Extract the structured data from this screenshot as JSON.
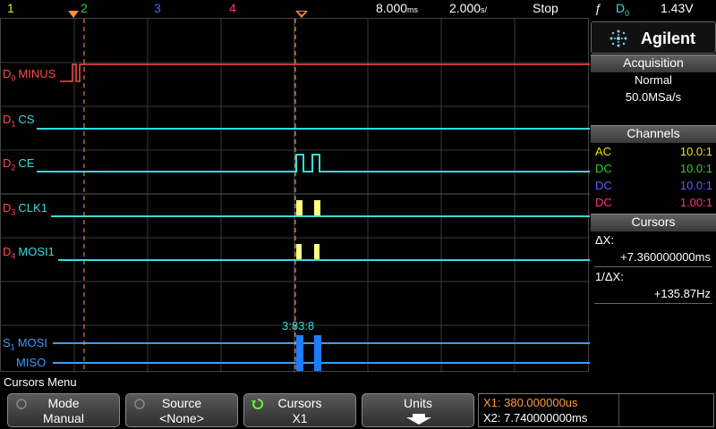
{
  "topbar": {
    "channels": [
      {
        "label": "1",
        "color": "#e8e800"
      },
      {
        "label": "2",
        "color": "#33cc33"
      },
      {
        "label": "3",
        "color": "#5a5aff"
      },
      {
        "label": "4",
        "color": "#ff2d8a"
      }
    ],
    "timebase_value": "8.000",
    "timebase_unit": "ms",
    "timediv_value": "2.000",
    "timediv_unit": "s/",
    "run_state": "Stop",
    "trigger_source": "D",
    "trigger_source_sub": "0",
    "trigger_level": "1.43V"
  },
  "traces": [
    {
      "prefix": "D",
      "sub": "0",
      "name": "MINUS",
      "color": "#ff4a4a"
    },
    {
      "prefix": "D",
      "sub": "1",
      "name": "CS",
      "color": "#33dddd"
    },
    {
      "prefix": "D",
      "sub": "2",
      "name": "CE",
      "color": "#33dddd"
    },
    {
      "prefix": "D",
      "sub": "3",
      "name": "CLK1",
      "color": "#33dddd"
    },
    {
      "prefix": "D",
      "sub": "4",
      "name": "MOSI1",
      "color": "#33dddd"
    },
    {
      "prefix": "S",
      "sub": "1",
      "name": "MOSI",
      "color": "#3a9cff"
    },
    {
      "prefix": "",
      "sub": "",
      "name": "MISO",
      "color": "#3a9cff"
    }
  ],
  "serial_decode_label": "3:83:8",
  "panel": {
    "brand": "Agilent",
    "acquisition_title": "Acquisition",
    "acquisition_mode": "Normal",
    "sample_rate": "50.0MSa/s",
    "channels_title": "Channels",
    "channel_rows": [
      {
        "coupling": "AC",
        "ratio": "10.0:1",
        "color": "#e8e800"
      },
      {
        "coupling": "DC",
        "ratio": "10.0:1",
        "color": "#33cc33"
      },
      {
        "coupling": "DC",
        "ratio": "10.0:1",
        "color": "#5a5aff"
      },
      {
        "coupling": "DC",
        "ratio": "1.00:1",
        "color": "#ff2d8a"
      }
    ],
    "cursors_title": "Cursors",
    "delta_x_label": "ΔX:",
    "delta_x_value": "+7.360000000ms",
    "inv_delta_x_label": "1/ΔX:",
    "inv_delta_x_value": "+135.87Hz"
  },
  "menu": {
    "title": "Cursors Menu",
    "keys": [
      {
        "label": "Mode",
        "value": "Manual"
      },
      {
        "label": "Source",
        "value": "<None>"
      },
      {
        "label": "Cursors",
        "value": "X1"
      },
      {
        "label": "Units",
        "value": ""
      }
    ],
    "x1_readout": "X1: 380.000000us",
    "x2_readout": "X2: 7.740000000ms"
  },
  "colors": {
    "x1_cursor": "#ff8c3a",
    "x2_cursor": "#ff8c3a",
    "accent": "#ffa040"
  }
}
